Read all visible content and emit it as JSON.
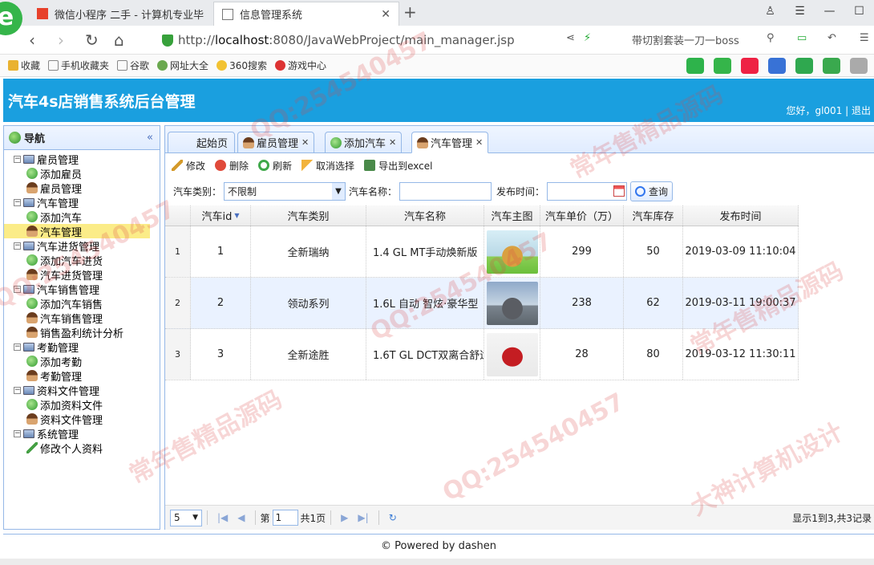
{
  "browser": {
    "tabs": [
      {
        "label": "微信小程序 二手 - 计算机专业毕",
        "active": false
      },
      {
        "label": "信息管理系统",
        "active": true
      }
    ],
    "url_scheme": "http://",
    "url_host": "localhost",
    "url_rest": ":8080/JavaWebProject/main_manager.jsp",
    "search_hint": "带切割套装一刀一boss",
    "bookmarks": [
      "收藏",
      "手机收藏夹",
      "谷歌",
      "网址大全",
      "360搜索",
      "游戏中心"
    ]
  },
  "app": {
    "title": "汽车4s店销售系统后台管理",
    "greeting": "您好，gl001 | 退出"
  },
  "nav": {
    "title": "导航",
    "tree": [
      {
        "label": "雇员管理",
        "level": 1,
        "icon": "computer-icon"
      },
      {
        "label": "添加雇员",
        "level": 2,
        "icon": "add-icon"
      },
      {
        "label": "雇员管理",
        "level": 2,
        "icon": "user-icon"
      },
      {
        "label": "汽车管理",
        "level": 1,
        "icon": "computer-icon"
      },
      {
        "label": "添加汽车",
        "level": 2,
        "icon": "add-icon"
      },
      {
        "label": "汽车管理",
        "level": 2,
        "icon": "user-icon",
        "selected": true
      },
      {
        "label": "汽车进货管理",
        "level": 1,
        "icon": "computer-icon"
      },
      {
        "label": "添加汽车进货",
        "level": 2,
        "icon": "add-icon"
      },
      {
        "label": "汽车进货管理",
        "level": 2,
        "icon": "user-icon"
      },
      {
        "label": "汽车销售管理",
        "level": 1,
        "icon": "computer-icon"
      },
      {
        "label": "添加汽车销售",
        "level": 2,
        "icon": "add-icon"
      },
      {
        "label": "汽车销售管理",
        "level": 2,
        "icon": "user-icon"
      },
      {
        "label": "销售盈利统计分析",
        "level": 2,
        "icon": "user-icon"
      },
      {
        "label": "考勤管理",
        "level": 1,
        "icon": "computer-icon"
      },
      {
        "label": "添加考勤",
        "level": 2,
        "icon": "add-icon"
      },
      {
        "label": "考勤管理",
        "level": 2,
        "icon": "user-icon"
      },
      {
        "label": "资料文件管理",
        "level": 1,
        "icon": "computer-icon"
      },
      {
        "label": "添加资料文件",
        "level": 2,
        "icon": "add-icon"
      },
      {
        "label": "资料文件管理",
        "level": 2,
        "icon": "user-icon"
      },
      {
        "label": "系统管理",
        "level": 1,
        "icon": "computer-icon"
      },
      {
        "label": "修改个人资料",
        "level": 2,
        "icon": "pencil-icon"
      }
    ]
  },
  "tabs": [
    {
      "label": "起始页",
      "closable": false
    },
    {
      "label": "雇员管理",
      "closable": true
    },
    {
      "label": "添加汽车",
      "closable": true
    },
    {
      "label": "汽车管理",
      "closable": true,
      "current": true
    }
  ],
  "toolbar": {
    "edit": "修改",
    "delete": "删除",
    "refresh": "刷新",
    "cancel": "取消选择",
    "export": "导出到excel"
  },
  "search": {
    "type_label": "汽车类别：",
    "type_value": "不限制",
    "name_label": "汽车名称：",
    "time_label": "发布时间：",
    "query_button": "查询"
  },
  "table": {
    "columns": [
      "汽车id",
      "汽车类别",
      "汽车名称",
      "汽车主图",
      "汽车单价（万）",
      "汽车库存",
      "发布时间"
    ],
    "rows": [
      {
        "rownum": "1",
        "id": "1",
        "type": "全新瑞纳",
        "name": "1.4 GL MT手动焕新版",
        "price": "299",
        "stock": "50",
        "time": "2019-03-09 11:10:04"
      },
      {
        "rownum": "2",
        "id": "2",
        "type": "领动系列",
        "name": "1.6L 自动 智炫·豪华型",
        "price": "238",
        "stock": "62",
        "time": "2019-03-11 19:00:37"
      },
      {
        "rownum": "3",
        "id": "3",
        "type": "全新途胜",
        "name": "1.6T GL DCT双离合舒适",
        "price": "28",
        "stock": "80",
        "time": "2019-03-12 11:30:11"
      }
    ]
  },
  "pager": {
    "page_size": "5",
    "page_label": "第",
    "page_value": "1",
    "total_pages": "共1页",
    "info": "显示1到3,共3记录"
  },
  "footer": "© Powered by dashen"
}
